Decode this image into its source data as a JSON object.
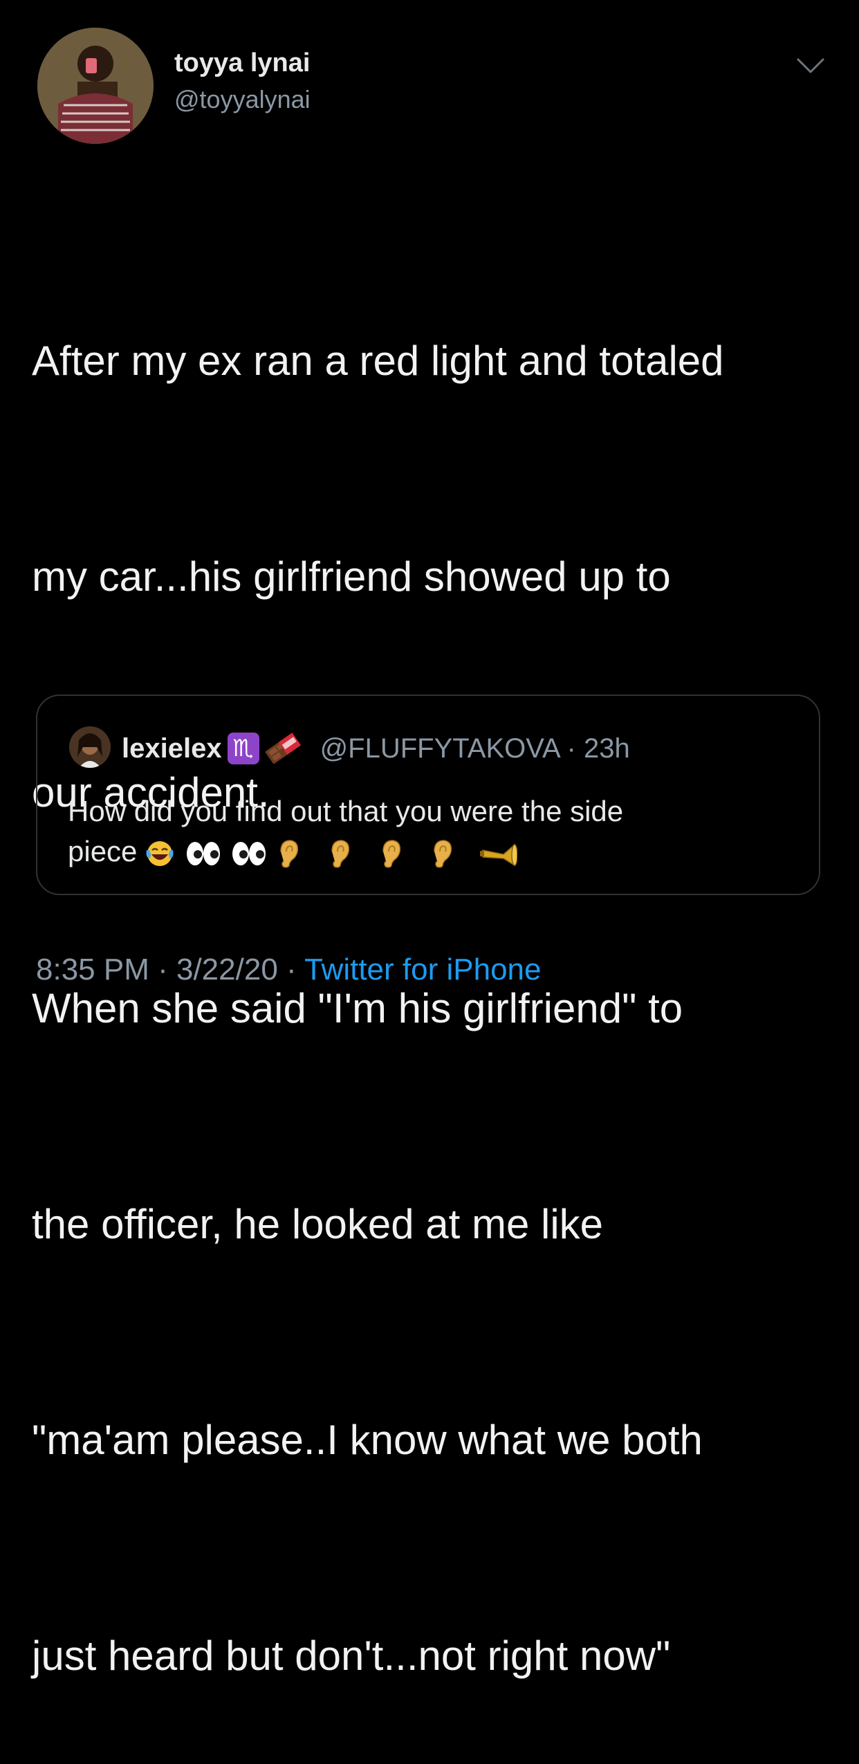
{
  "author": {
    "display_name": "toyya lynai",
    "handle": "@toyyalynai"
  },
  "tweet": {
    "lines": [
      "After my ex ran a red light and totaled",
      "my car...his girlfriend showed up to",
      "our accident.",
      "When she said \"I'm his girlfriend\" to",
      "the officer, he looked at me like",
      "\"ma'am please..I know what we both",
      "just heard but don't...not right now\""
    ]
  },
  "quoted": {
    "display_name": "lexielex",
    "scorpio_glyph": "♏",
    "handle_time": "@FLUFFYTAKOVA · 23h",
    "text_line1": "How did you find out that you were the side",
    "text_line2": "piece"
  },
  "footer": {
    "time": "8:35 PM",
    "sep1": " · ",
    "date": "3/22/20",
    "sep2": " · ",
    "source": "Twitter for iPhone"
  },
  "colors": {
    "background": "#000000",
    "text": "#f2f2f2",
    "secondary": "#8b98a5",
    "link": "#1d9bf0",
    "card_border": "#2f3336"
  }
}
